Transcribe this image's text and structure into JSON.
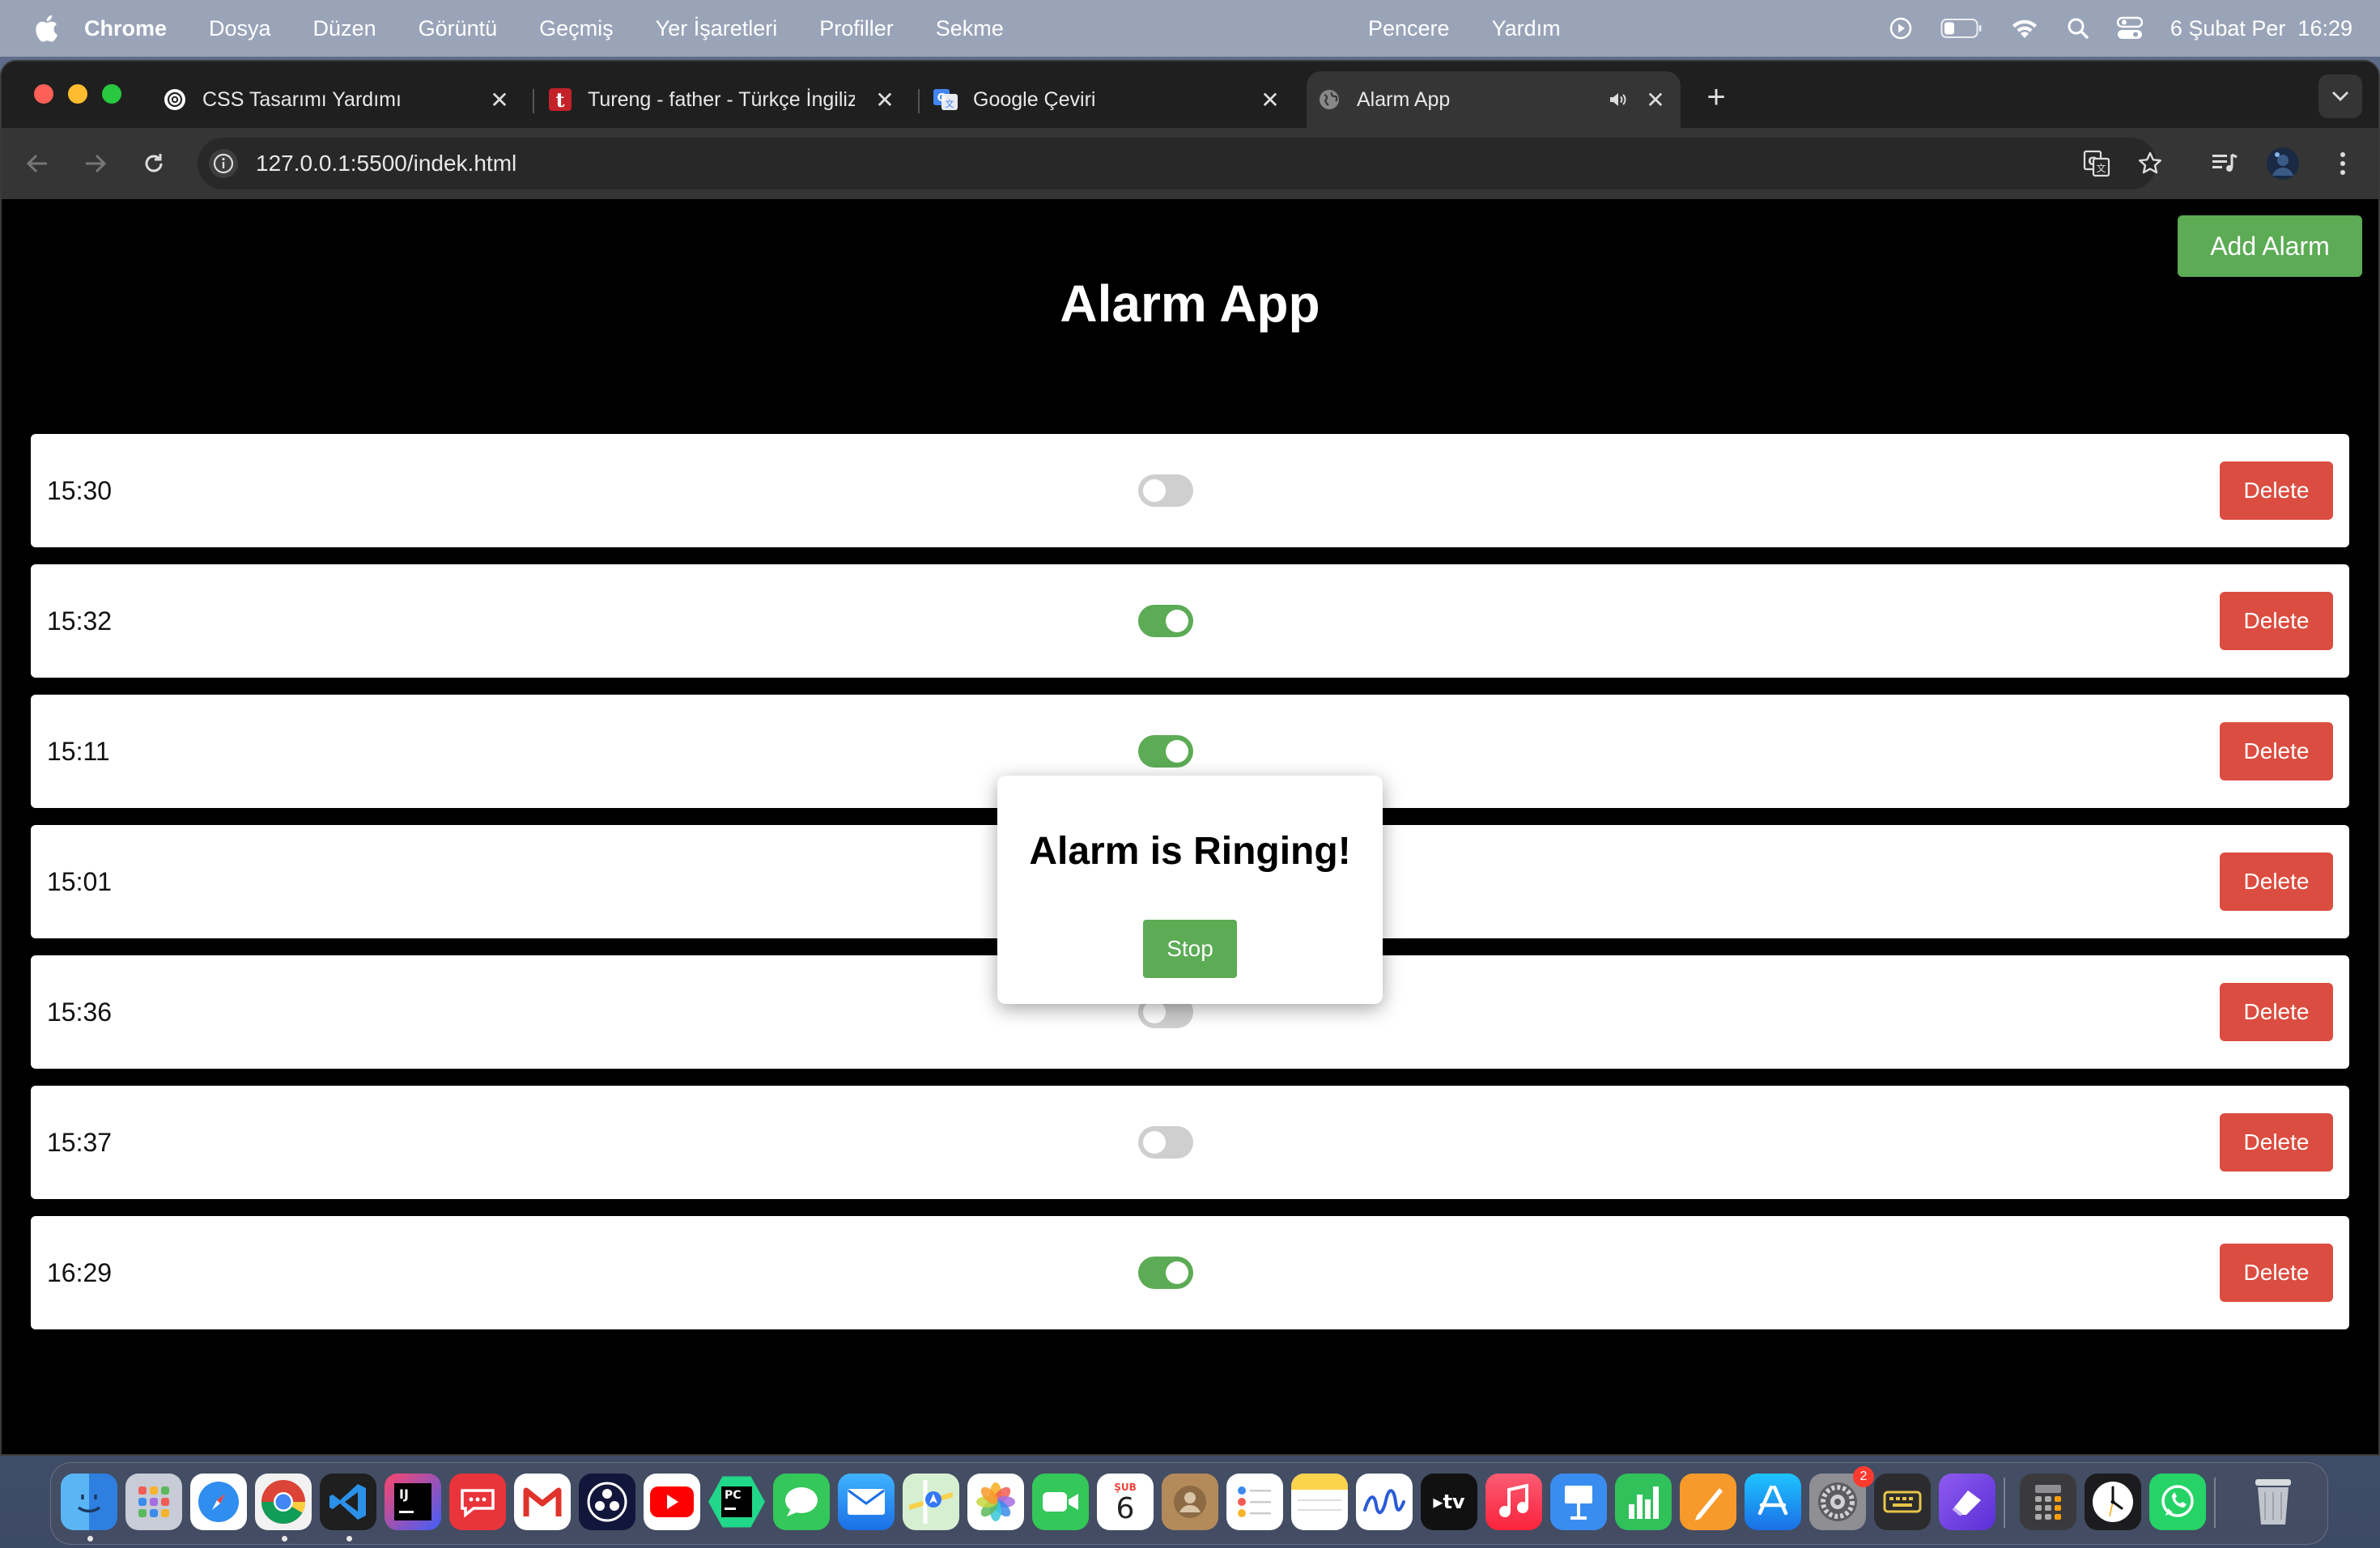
{
  "menubar": {
    "app_name": "Chrome",
    "items": [
      "Dosya",
      "Düzen",
      "Görüntü",
      "Geçmiş",
      "Yer İşaretleri",
      "Profiller",
      "Sekme"
    ],
    "center_items": [
      "Pencere",
      "Yardım"
    ],
    "clock": "6 Şubat Per  16:29"
  },
  "tabs": [
    {
      "title": "CSS Tasarımı Yardımı",
      "icon": "chatgpt-icon"
    },
    {
      "title": "Tureng - father - Türkçe İngiliz",
      "icon": "tureng-icon"
    },
    {
      "title": "Google Çeviri",
      "icon": "google-translate-icon"
    },
    {
      "title": "Alarm App",
      "icon": "globe-icon",
      "active": true
    }
  ],
  "address_bar": {
    "url": "127.0.0.1:5500/indek.html"
  },
  "page": {
    "add_alarm_label": "Add Alarm",
    "title": "Alarm App",
    "alarms": [
      {
        "time": "15:30",
        "enabled": false,
        "delete_label": "Delete"
      },
      {
        "time": "15:32",
        "enabled": true,
        "delete_label": "Delete"
      },
      {
        "time": "15:11",
        "enabled": true,
        "delete_label": "Delete"
      },
      {
        "time": "15:01",
        "enabled": false,
        "delete_label": "Delete"
      },
      {
        "time": "15:36",
        "enabled": false,
        "delete_label": "Delete"
      },
      {
        "time": "15:37",
        "enabled": false,
        "delete_label": "Delete"
      },
      {
        "time": "16:29",
        "enabled": true,
        "delete_label": "Delete"
      }
    ],
    "modal": {
      "title": "Alarm is Ringing!",
      "stop_label": "Stop"
    }
  },
  "colors": {
    "accent_green": "#5cab55",
    "delete_red": "#db4d40",
    "page_background": "#000000"
  },
  "dock": {
    "calendar_month": "ŞUB",
    "calendar_day": "6",
    "settings_badge": "2",
    "apps": [
      "finder-icon",
      "launchpad-icon",
      "safari-icon",
      "chrome-icon",
      "vscode-icon",
      "intellij-icon",
      "speeko-icon",
      "gmail-icon",
      "obs-icon",
      "youtube-icon",
      "pycharm-icon",
      "messages-icon",
      "mail-icon",
      "maps-icon",
      "photos-icon",
      "facetime-icon",
      "calendar-icon",
      "contacts-icon",
      "reminders-icon",
      "notes-icon",
      "freeform-icon",
      "tv-icon",
      "music-icon",
      "keynote-icon",
      "numbers-icon",
      "pages-icon",
      "app-store-icon",
      "system-settings-icon",
      "keyboard-icon",
      "eraser-icon",
      "calculator-icon",
      "clock-icon",
      "whatsapp-icon",
      "trash-icon"
    ]
  }
}
